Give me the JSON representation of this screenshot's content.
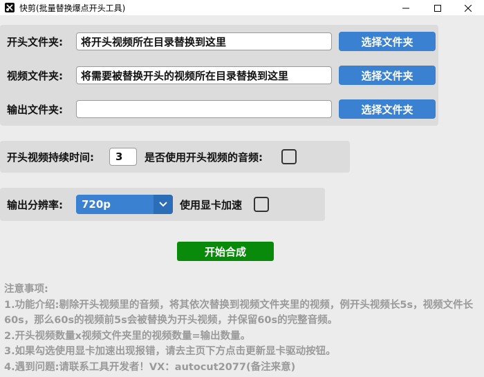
{
  "window": {
    "title": "快剪(批量替换爆点开头工具)"
  },
  "folders": {
    "opening_label": "开头文件夹:",
    "opening_value": "将开头视频所在目录替换到这里",
    "video_label": "视频文件夹:",
    "video_value": "将需要被替换开头的视频所在目录替换到这里",
    "output_label": "输出文件夹:",
    "output_value": "",
    "choose_label": "选择文件夹"
  },
  "duration": {
    "label": "开头视频持续时间:",
    "value": "3",
    "use_audio_label": "是否使用开头视频的音频:",
    "use_audio_checked": false
  },
  "resolution": {
    "label": "输出分辨率:",
    "selected": "720p",
    "gpu_label": "使用显卡加速",
    "gpu_checked": false
  },
  "actions": {
    "start_label": "开始合成"
  },
  "notes": {
    "title": "注意事项:",
    "lines": [
      "1.功能介绍:剔除开头视频里的音频，将其依次替换到视频文件夹里的视频，例开头视频长5s，视频文件长60s，那么60s的视频前5s会被替换为开头视频，并保留60s的完整音频。",
      "2.开头视频数量x视频文件夹里的视频数量=输出数量。",
      "3.如果勾选使用显卡加速出现报错，请去主页下方点击更新显卡驱动按钮。",
      "4.遇到问题:请联系工具开发者！VX：autocut2077(备注来意)"
    ]
  },
  "colors": {
    "accent_blue": "#3a82d1",
    "start_green": "#0a8a0a",
    "panel_gray": "#dcdcdc",
    "background": "#ececec",
    "notes_gray": "#9a9a9a"
  }
}
